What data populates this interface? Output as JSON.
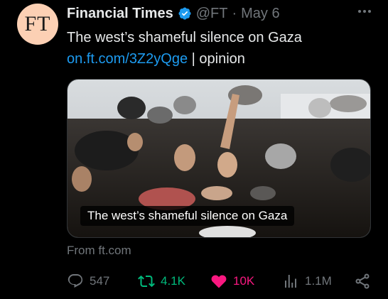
{
  "tweet": {
    "avatar_text": "FT",
    "author_name": "Financial Times",
    "handle": "@FT",
    "separator": "·",
    "date": "May 6",
    "headline": "The west’s shameful silence on Gaza",
    "link_text": "on.ft.com/3Z2yQge",
    "link_suffix": " | opinion",
    "card_caption": "The west’s shameful silence on Gaza",
    "card_source": "From ft.com"
  },
  "actions": {
    "replies": "547",
    "retweets": "4.1K",
    "likes": "10K",
    "views": "1.1M"
  },
  "colors": {
    "background": "#000000",
    "text": "#e7e9ea",
    "muted": "#71767b",
    "link": "#1d9bf0",
    "retweet_active": "#00ba7c",
    "like_active": "#f91880",
    "verified": "#1d9bf0",
    "avatar_bg": "#fcd0b4"
  },
  "icons": [
    "verified-icon",
    "more-icon",
    "reply-icon",
    "retweet-icon",
    "like-icon",
    "views-icon",
    "share-icon"
  ]
}
